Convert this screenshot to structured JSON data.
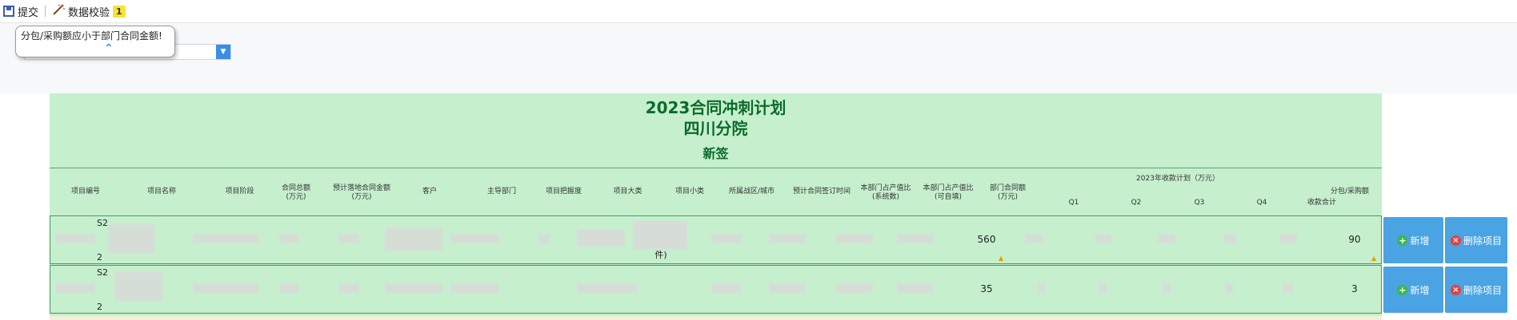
{
  "toolbar": {
    "submit_label": "提交",
    "validate_label": "数据校验",
    "validate_count": "1"
  },
  "tooltip": {
    "message": "分包/采购额应小于部门合同金额!"
  },
  "sheet": {
    "title": "2023合同冲刺计划",
    "subtitle": "四川分院",
    "section": "新签"
  },
  "headers": {
    "project_no": "项目编号",
    "project_name": "项目名称",
    "project_stage": "项目阶段",
    "contract_amount": "合同总额\n(万元)",
    "expected_amount": "预计落地合同金额\n(万元)",
    "customer": "客户",
    "lead_dept": "主导部门",
    "grip": "项目把握度",
    "category": "项目大类",
    "subcategory": "项目小类",
    "region": "所属战区/城市",
    "sign_time": "预计合同签订时间",
    "ratio_system": "本部门占产值比\n(系统数)",
    "ratio_editable": "本部门占产值比\n(可自填)",
    "dept_amount": "部门合同额\n(万元)",
    "plan_group": "2023年收款计划（万元）",
    "q1": "Q1",
    "q2": "Q2",
    "q3": "Q3",
    "q4": "Q4",
    "total": "收款合计",
    "subcontract": "分包/采购额"
  },
  "rows": [
    {
      "code_top": "S2",
      "code_bottom": "2",
      "name_fragment": "",
      "subcategory_fragment": "件)",
      "dept_amount": "560",
      "subcontract": "90"
    },
    {
      "code_top": "S2",
      "code_bottom": "2",
      "name_fragment": "",
      "subcategory_fragment": "",
      "dept_amount": "35",
      "subcontract": "3"
    }
  ],
  "actions": {
    "add_label": "新增",
    "delete_label": "删除项目"
  },
  "colors": {
    "sheet_bg": "#c6efce",
    "title_green": "#0b6b2a",
    "action_blue": "#4aa3e3"
  }
}
